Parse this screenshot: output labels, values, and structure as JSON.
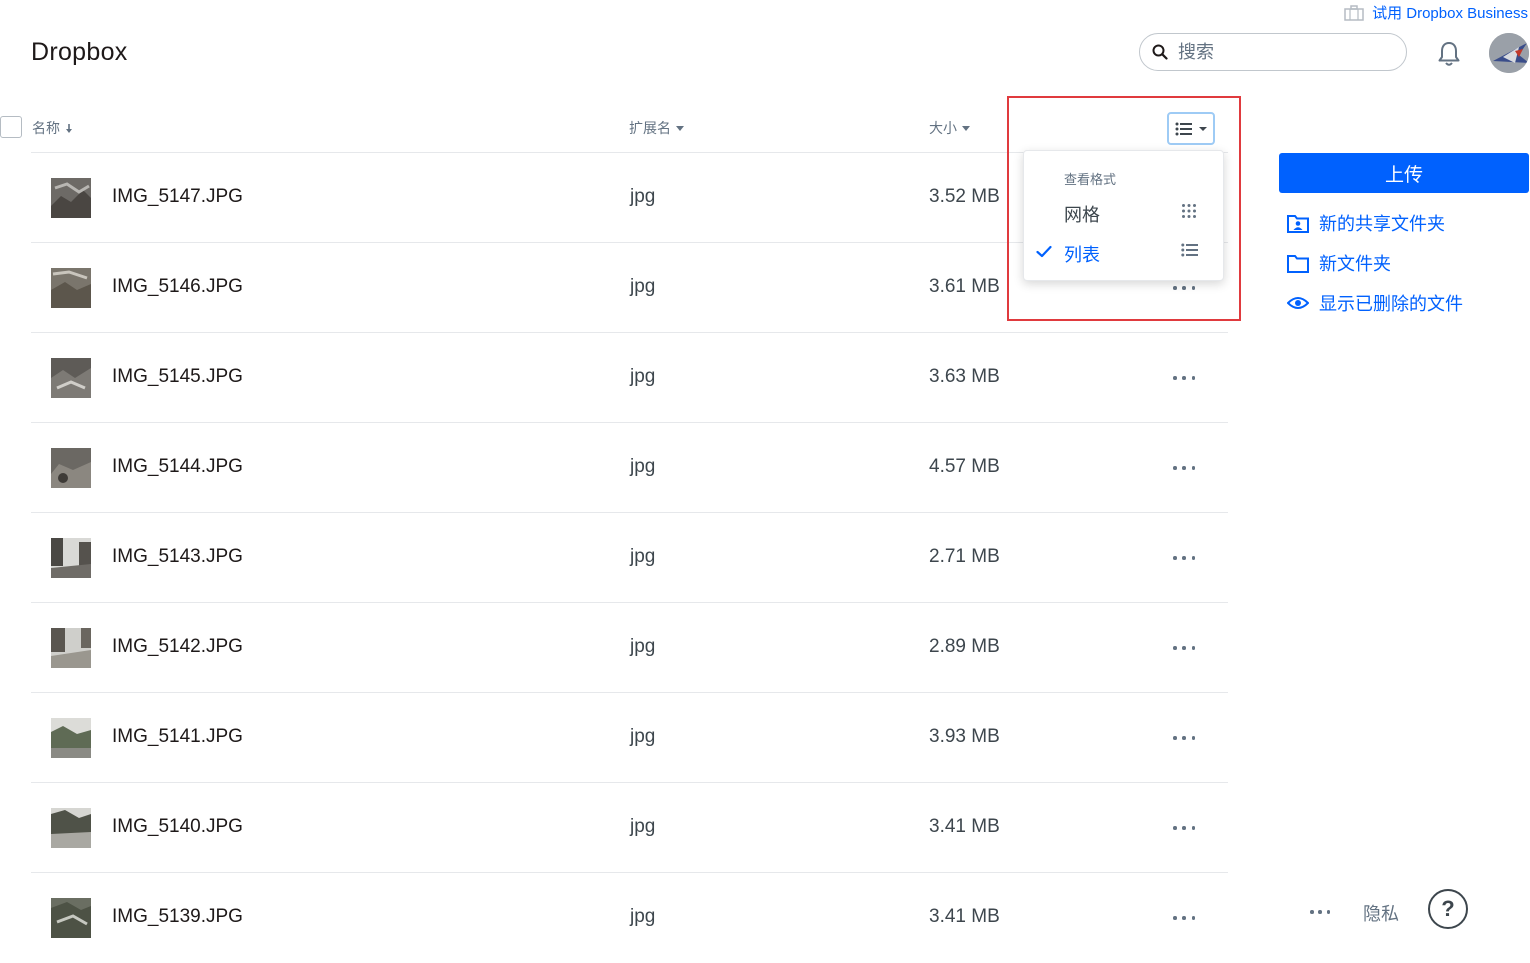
{
  "header": {
    "business_link": "试用 Dropbox Business",
    "brand": "Dropbox",
    "search_placeholder": "搜索"
  },
  "table": {
    "columns": {
      "name": "名称",
      "ext": "扩展名",
      "size": "大小"
    },
    "rows": [
      {
        "name": "IMG_5147.JPG",
        "ext": "jpg",
        "size": "3.52 MB"
      },
      {
        "name": "IMG_5146.JPG",
        "ext": "jpg",
        "size": "3.61 MB"
      },
      {
        "name": "IMG_5145.JPG",
        "ext": "jpg",
        "size": "3.63 MB"
      },
      {
        "name": "IMG_5144.JPG",
        "ext": "jpg",
        "size": "4.57 MB"
      },
      {
        "name": "IMG_5143.JPG",
        "ext": "jpg",
        "size": "2.71 MB"
      },
      {
        "name": "IMG_5142.JPG",
        "ext": "jpg",
        "size": "2.89 MB"
      },
      {
        "name": "IMG_5141.JPG",
        "ext": "jpg",
        "size": "3.93 MB"
      },
      {
        "name": "IMG_5140.JPG",
        "ext": "jpg",
        "size": "3.41 MB"
      },
      {
        "name": "IMG_5139.JPG",
        "ext": "jpg",
        "size": "3.41 MB"
      }
    ]
  },
  "view_menu": {
    "title": "查看格式",
    "grid_label": "网格",
    "list_label": "列表",
    "selected": "list"
  },
  "sidebar": {
    "upload": "上传",
    "new_shared_folder": "新的共享文件夹",
    "new_folder": "新文件夹",
    "show_deleted": "显示已删除的文件"
  },
  "footer": {
    "privacy": "隐私",
    "help": "?"
  },
  "colors": {
    "accent": "#0061fe",
    "highlight_border": "#e03a3e"
  }
}
